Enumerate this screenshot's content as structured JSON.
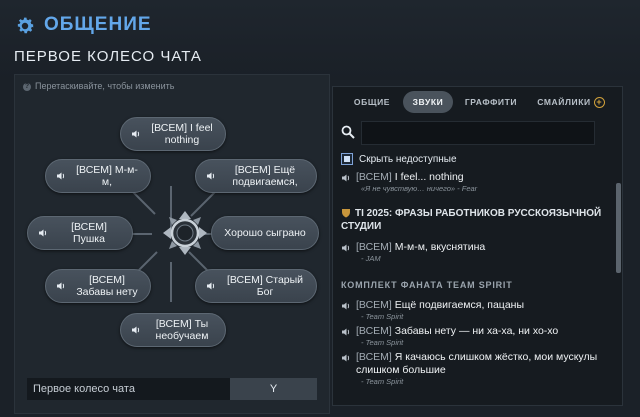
{
  "header": {
    "title": "ОБЩЕНИЕ",
    "subtitle": "ПЕРВОЕ КОЛЕСО ЧАТА"
  },
  "wheel": {
    "hint": "Перетаскивайте, чтобы изменить",
    "buttons": [
      {
        "id": "top",
        "label": "[ВСЕМ] I feel nothing"
      },
      {
        "id": "top-right",
        "label": "[ВСЕМ] Ещё подвигаемся,"
      },
      {
        "id": "right",
        "label": "Хорошо сыграно"
      },
      {
        "id": "bottom-right",
        "label": "[ВСЕМ] Старый Бог"
      },
      {
        "id": "bottom",
        "label": "[ВСЕМ] Ты необучаем"
      },
      {
        "id": "bottom-left",
        "label": "[ВСЕМ] Забавы нету"
      },
      {
        "id": "left",
        "label": "[ВСЕМ] Пушка"
      },
      {
        "id": "top-left",
        "label": "[ВСЕМ] М-м-м,"
      }
    ],
    "name_value": "Первое колесо чата",
    "key": "Y"
  },
  "tabs": [
    {
      "label": "ОБЩИЕ",
      "active": false
    },
    {
      "label": "ЗВУКИ",
      "active": true
    },
    {
      "label": "ГРАФФИТИ",
      "active": false
    },
    {
      "label": "СМАЙЛИКИ",
      "active": false
    }
  ],
  "search": {
    "placeholder": ""
  },
  "hide_unavailable": {
    "label": "Скрыть недоступные",
    "checked": true
  },
  "list": {
    "item1": {
      "tag": "[ВСЕМ]",
      "text": " I feel... nothing",
      "source": "«Я не чувствую… ничего» - Fear"
    },
    "group1": "TI 2025: ФРАЗЫ РАБОТНИКОВ РУССКОЯЗЫЧНОЙ СТУДИИ",
    "item2": {
      "tag": "[ВСЕМ]",
      "text": " М-м-м, вкуснятина",
      "source": "- JAM"
    },
    "group2": "КОМПЛЕКТ ФАНАТА TEAM SPIRIT",
    "item3": {
      "tag": "[ВСЕМ]",
      "text": " Ещё подвигаемся, пацаны",
      "source": "- Team Spirit"
    },
    "item4": {
      "tag": "[ВСЕМ]",
      "text": " Забавы нету — ни ха-ха, ни хо-хо",
      "source": "- Team Spirit"
    },
    "item5": {
      "tag": "[ВСЕМ]",
      "text": " Я качаюсь слишком жёстко, мои мускулы слишком большие",
      "source": "- Team Spirit"
    }
  },
  "colors": {
    "accent": "#63a7ea",
    "gold": "#d1a13b"
  }
}
